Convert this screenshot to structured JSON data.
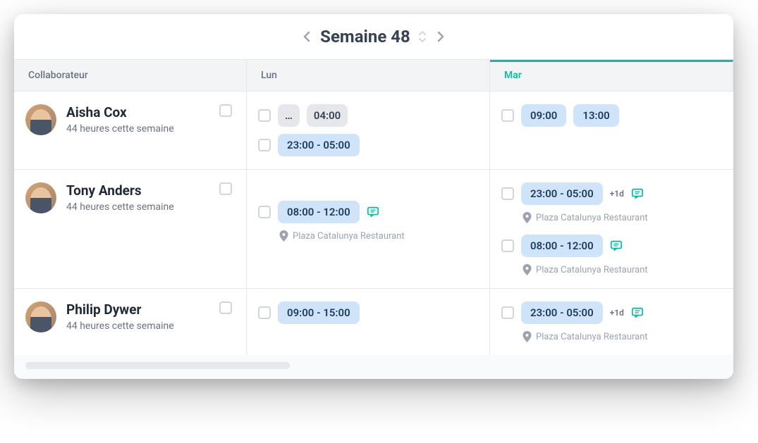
{
  "header": {
    "week_label": "Semaine 48"
  },
  "columns": {
    "collab": "Collaborateur",
    "mon": "Lun",
    "tue": "Mar"
  },
  "collaborators": [
    {
      "name": "Aisha Cox",
      "hours": "44 heures cette semaine",
      "mon": {
        "row1_prefix": "…",
        "row1_time": "04:00",
        "row2_time": "23:00 - 05:00"
      },
      "tue": {
        "row1_time1": "09:00",
        "row1_time2": "13:00"
      }
    },
    {
      "name": "Tony Anders",
      "hours": "44 heures cette semaine",
      "mon": {
        "row1_time": "08:00 - 12:00",
        "location": "Plaza Catalunya Restaurant"
      },
      "tue": {
        "row1_time": "23:00 - 05:00",
        "row1_badge": "+1d",
        "row1_location": "Plaza Catalunya Restaurant",
        "row2_time": "08:00 - 12:00",
        "row2_location": "Plaza Catalunya Restaurant"
      }
    },
    {
      "name": "Philip Dywer",
      "hours": "44 heures cette semaine",
      "mon": {
        "row1_time": "09:00 - 15:00"
      },
      "tue": {
        "row1_time": "23:00 - 05:00",
        "row1_badge": "+1d",
        "row1_location": "Plaza Catalunya Restaurant"
      }
    }
  ]
}
